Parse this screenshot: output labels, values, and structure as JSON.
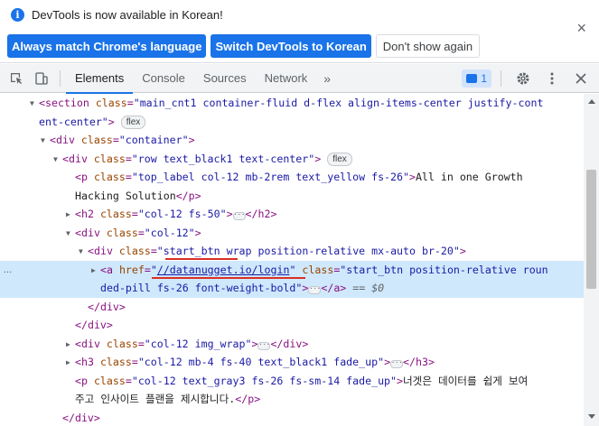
{
  "infobar": {
    "message": "DevTools is now available in Korean!",
    "buttons": [
      "Always match Chrome's language",
      "Switch DevTools to Korean",
      "Don't show again"
    ],
    "close": "×"
  },
  "toolbar": {
    "tabs": [
      "Elements",
      "Console",
      "Sources",
      "Network"
    ],
    "more": "»",
    "issues_count": "1",
    "active_tab": "Elements"
  },
  "tree": {
    "l1": {
      "open": "<section",
      "cls_attr": "class",
      "cls_val": "\"main_cnt1 container-fluid d-flex align-items-center justify-cont",
      "close": ">"
    },
    "l2": {
      "cls_val": "ent-center\"",
      "close": ">",
      "badge": "flex"
    },
    "l3": {
      "open": "<div",
      "cls_attr": "class",
      "cls_val": "\"container\"",
      "close": ">"
    },
    "l4": {
      "open": "<div",
      "cls_attr": "class",
      "cls_val": "\"row text_black1 text-center\"",
      "close": ">",
      "badge": "flex"
    },
    "l5": {
      "open": "<p",
      "cls_attr": "class",
      "cls_val": "\"top_label col-12 mb-2rem text_yellow fs-26\"",
      "close": ">",
      "text": "All in one Growth"
    },
    "l6": {
      "text": "Hacking Solution",
      "close": "</p>"
    },
    "l7": {
      "open": "<h2",
      "cls_attr": "class",
      "cls_val": "\"col-12 fs-50\"",
      "close": ">",
      "end": "</h2>"
    },
    "l8": {
      "open": "<div",
      "cls_attr": "class",
      "cls_val": "\"col-12\"",
      "close": ">"
    },
    "l9": {
      "open": "<div",
      "cls_attr": "class",
      "cls_val_a": "\"start_btn",
      "cls_val_b": " wrap position-relative mx-auto br-20\"",
      "close": ">"
    },
    "l10": {
      "dots": "...",
      "open": "<a",
      "href_attr": "href",
      "href_q": "\"",
      "href_val": "//datanugget.io/login",
      "href_q2": "\"",
      "cls_attr": "class",
      "cls_val": "\"start_btn position-relative roun",
      "close": ""
    },
    "l11": {
      "cls_val": "ded-pill fs-26 font-weight-bold\"",
      "close": ">",
      "end": "</a>",
      "eq": "== $0"
    },
    "l12": {
      "text": "</div>"
    },
    "l13": {
      "text": "</div>"
    },
    "l14": {
      "open": "<div",
      "cls_attr": "class",
      "cls_val": "\"col-12 img_wrap\"",
      "close": ">",
      "end": "</div>"
    },
    "l15": {
      "open": "<h3",
      "cls_attr": "class",
      "cls_val": "\"col-12 mb-4 fs-40 text_black1 fade_up\"",
      "close": ">",
      "end": "</h3>"
    },
    "l16": {
      "open": "<p",
      "cls_attr": "class",
      "cls_val": "\"col-12 text_gray3 fs-26 fs-sm-14 fade_up\"",
      "close": ">",
      "text": "너겟은 데이터를 쉽게 보여"
    },
    "l17": {
      "text": "주고 인사이트 플랜을 제시합니다.",
      "close": "</p>"
    },
    "l18": {
      "text": "</div>"
    }
  },
  "colors": {
    "accent": "#1a73e8",
    "selected_row": "#cfe8fc",
    "annotation": "#d93025"
  }
}
